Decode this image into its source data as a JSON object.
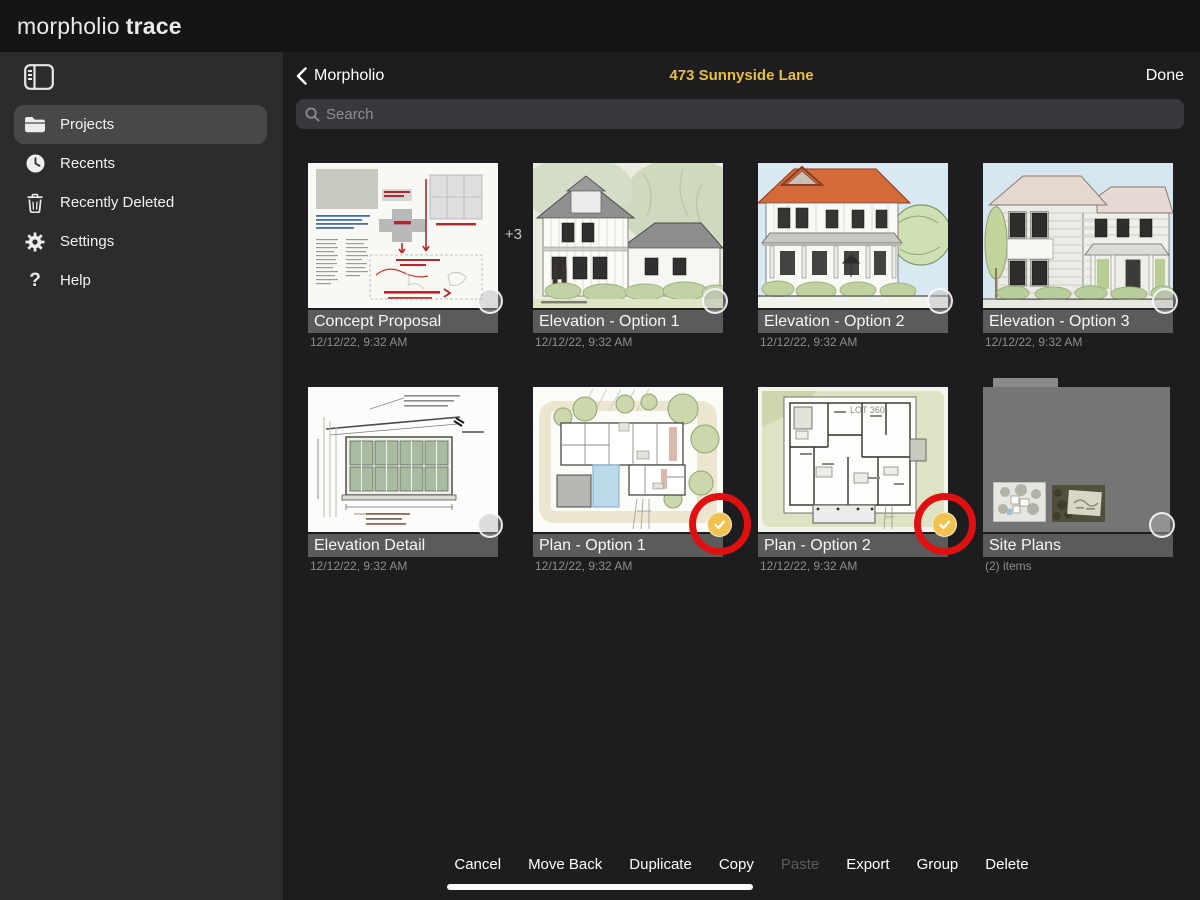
{
  "app": {
    "logo": {
      "primary": "morpholio",
      "secondary": "trace"
    }
  },
  "sidebar": {
    "items": [
      {
        "label": "Projects",
        "icon": "folder-icon",
        "active": true
      },
      {
        "label": "Recents",
        "icon": "clock-icon",
        "active": false
      },
      {
        "label": "Recently Deleted",
        "icon": "trash-icon",
        "active": false
      },
      {
        "label": "Settings",
        "icon": "gear-icon",
        "active": false
      },
      {
        "label": "Help",
        "icon": "help-icon",
        "active": false
      }
    ]
  },
  "header": {
    "back_label": "Morpholio",
    "title": "473 Sunnyside Lane",
    "done_label": "Done"
  },
  "search": {
    "placeholder": "Search"
  },
  "grid": {
    "projects": [
      {
        "title": "Concept Proposal",
        "meta": "12/12/22, 9:32 AM",
        "badge": "+3",
        "selected": false,
        "type": "stacked-drawing"
      },
      {
        "title": "Elevation - Option 1",
        "meta": "12/12/22, 9:32 AM",
        "selected": false,
        "type": "drawing"
      },
      {
        "title": "Elevation - Option 2",
        "meta": "12/12/22, 9:32 AM",
        "selected": false,
        "type": "drawing"
      },
      {
        "title": "Elevation - Option 3",
        "meta": "12/12/22, 9:32 AM",
        "selected": false,
        "type": "drawing"
      },
      {
        "title": "Elevation Detail",
        "meta": "12/12/22, 9:32 AM",
        "selected": false,
        "type": "drawing"
      },
      {
        "title": "Plan - Option 1",
        "meta": "12/12/22, 9:32 AM",
        "selected": true,
        "annotated": true,
        "type": "drawing"
      },
      {
        "title": "Plan - Option 2",
        "meta": "12/12/22, 9:32 AM",
        "selected": true,
        "annotated": true,
        "type": "drawing",
        "thumbnail_text": "LOT 360"
      },
      {
        "title": "Site Plans",
        "meta": "(2) items",
        "selected": false,
        "type": "folder"
      }
    ]
  },
  "toolbar": {
    "buttons": [
      {
        "label": "Cancel",
        "enabled": true
      },
      {
        "label": "Move Back",
        "enabled": true
      },
      {
        "label": "Duplicate",
        "enabled": true
      },
      {
        "label": "Copy",
        "enabled": true
      },
      {
        "label": "Paste",
        "enabled": false
      },
      {
        "label": "Export",
        "enabled": true
      },
      {
        "label": "Group",
        "enabled": true
      },
      {
        "label": "Delete",
        "enabled": true
      }
    ]
  },
  "colors": {
    "header_title": "#e8be44",
    "selection_check": "#f1c24f",
    "annotation_ring": "#e11010",
    "sidebar_bg": "#2c2c2e",
    "main_bg": "#1d1d1f"
  }
}
